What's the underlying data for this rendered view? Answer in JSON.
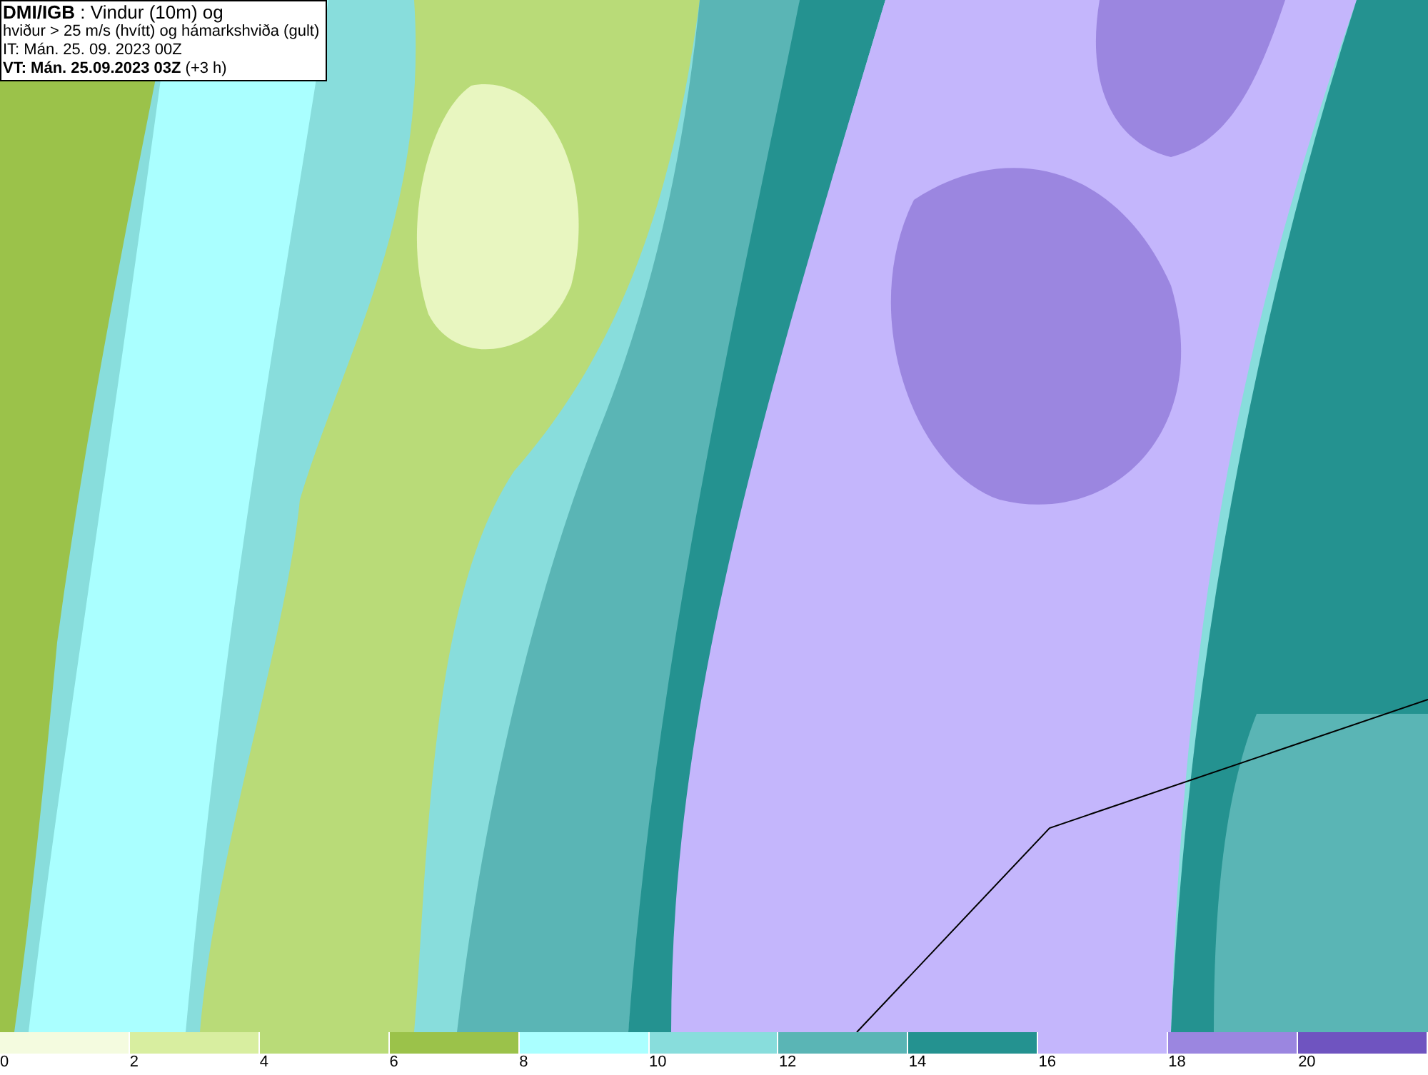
{
  "header": {
    "lines": [
      "**DMI/IGB** : Vindur (10m) og",
      "hviður > 25 m/s (hvítt) og hámarkshviða (gult)",
      "IT: Mán. 25. 09. 2023 00Z",
      "**VT: Mán. 25.09.2023 03Z** (+3 h)"
    ]
  },
  "legend": [
    {
      "label": "0",
      "color": "#f4fbdf"
    },
    {
      "label": "2",
      "color": "#d8eea0"
    },
    {
      "label": "4",
      "color": "#b9db78"
    },
    {
      "label": "6",
      "color": "#9bc24a"
    },
    {
      "label": "8",
      "color": "#aaffff"
    },
    {
      "label": "10",
      "color": "#88dddc"
    },
    {
      "label": "12",
      "color": "#5ab5b5"
    },
    {
      "label": "14",
      "color": "#249290"
    },
    {
      "label": "16",
      "color": "#c4b6fc"
    },
    {
      "label": "18",
      "color": "#9b86e0"
    },
    {
      "label": "20",
      "color": "#6f54c0"
    }
  ]
}
